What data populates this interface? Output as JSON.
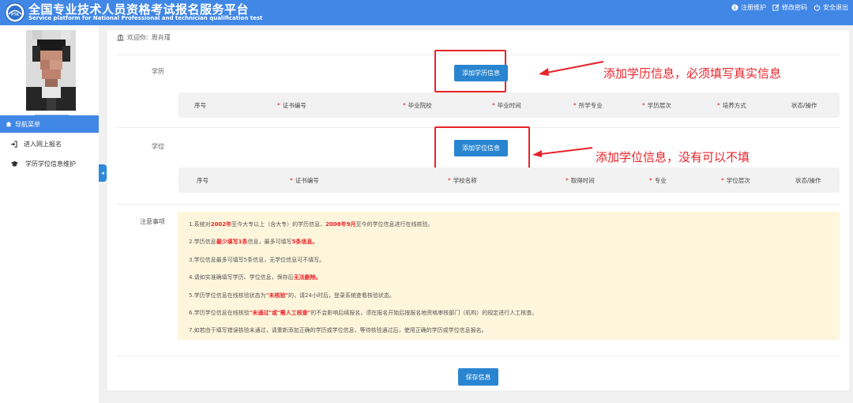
{
  "header": {
    "title": "全国专业技术人员资格考试报名服务平台",
    "subtitle": "Service platform for National Professional and technician qualification test",
    "links": [
      {
        "label": "注册维护",
        "icon": "info-icon"
      },
      {
        "label": "修改密码",
        "icon": "edit-icon"
      },
      {
        "label": "安全退出",
        "icon": "power-icon"
      }
    ]
  },
  "sidebar": {
    "nav_title": "导航菜单",
    "items": [
      {
        "label": "进入网上报名",
        "icon": "sign-in-icon"
      },
      {
        "label": "学历学位信息维护",
        "icon": "graduation-cap-icon"
      }
    ]
  },
  "welcome": {
    "prefix": "欢迎你:",
    "name": "周肖瑾"
  },
  "education": {
    "label": "学历",
    "add_button": "添加学历信息",
    "annotation": "添加学历信息，必须填写真实信息",
    "columns": [
      {
        "label": "序号",
        "required": false
      },
      {
        "label": "证书编号",
        "required": true
      },
      {
        "label": "毕业院校",
        "required": true
      },
      {
        "label": "毕业时间",
        "required": true
      },
      {
        "label": "所学专业",
        "required": true
      },
      {
        "label": "学历层次",
        "required": true
      },
      {
        "label": "培养方式",
        "required": true
      },
      {
        "label": "状态/操作",
        "required": false
      }
    ]
  },
  "degree": {
    "label": "学位",
    "add_button": "添加学位信息",
    "annotation": "添加学位信息，没有可以不填",
    "columns": [
      {
        "label": "序号",
        "required": false
      },
      {
        "label": "证书编号",
        "required": true
      },
      {
        "label": "学校名称",
        "required": true
      },
      {
        "label": "取得时间",
        "required": true
      },
      {
        "label": "专业",
        "required": true
      },
      {
        "label": "学位层次",
        "required": true
      },
      {
        "label": "状态/操作",
        "required": false
      }
    ]
  },
  "notice": {
    "label": "注意事项",
    "lines": [
      [
        {
          "t": "1.系统对"
        },
        {
          "t": "2002年",
          "h": true
        },
        {
          "t": "至今大专以上（含大专）的学历信息、"
        },
        {
          "t": "2008年9月",
          "h": true
        },
        {
          "t": "至今的学位信息进行在线核验。"
        }
      ],
      [
        {
          "t": "2.学历信息"
        },
        {
          "t": "最少填写1条",
          "h": true
        },
        {
          "t": "信息，最多可填写"
        },
        {
          "t": "5条信息。",
          "h": true
        }
      ],
      [
        {
          "t": "3.学位信息最多可填写5条信息，无学位信息可不填写。"
        }
      ],
      [
        {
          "t": "4.请如实准确填写学历、学位信息，保存后"
        },
        {
          "t": "无法删除。",
          "h": true
        }
      ],
      [
        {
          "t": "5.学历学位信息在线核验状态为"
        },
        {
          "t": "\"未核验\"",
          "h": true
        },
        {
          "t": "的，请24小时后，登录系统查看核验状态。"
        }
      ],
      [
        {
          "t": "6.学历学位信息在线核验"
        },
        {
          "t": "\"未通过\"或\"需人工核查\"",
          "h": true
        },
        {
          "t": "的不会影响后续报名，须在报名开始后按报名地资格审核部门（机构）的规定进行人工核查。"
        }
      ],
      [
        {
          "t": "7.如若由于填写错误核验未通过，请重新添加正确的学历或学位信息，等待核验通过后，使用正确的学历或学位信息报名。"
        }
      ]
    ]
  },
  "save_button": "保存信息",
  "colors": {
    "header_blue": "#4187e6",
    "button_blue": "#2a85d0",
    "annotation_red": "#e8232a",
    "notice_bg": "#fef6dc"
  }
}
